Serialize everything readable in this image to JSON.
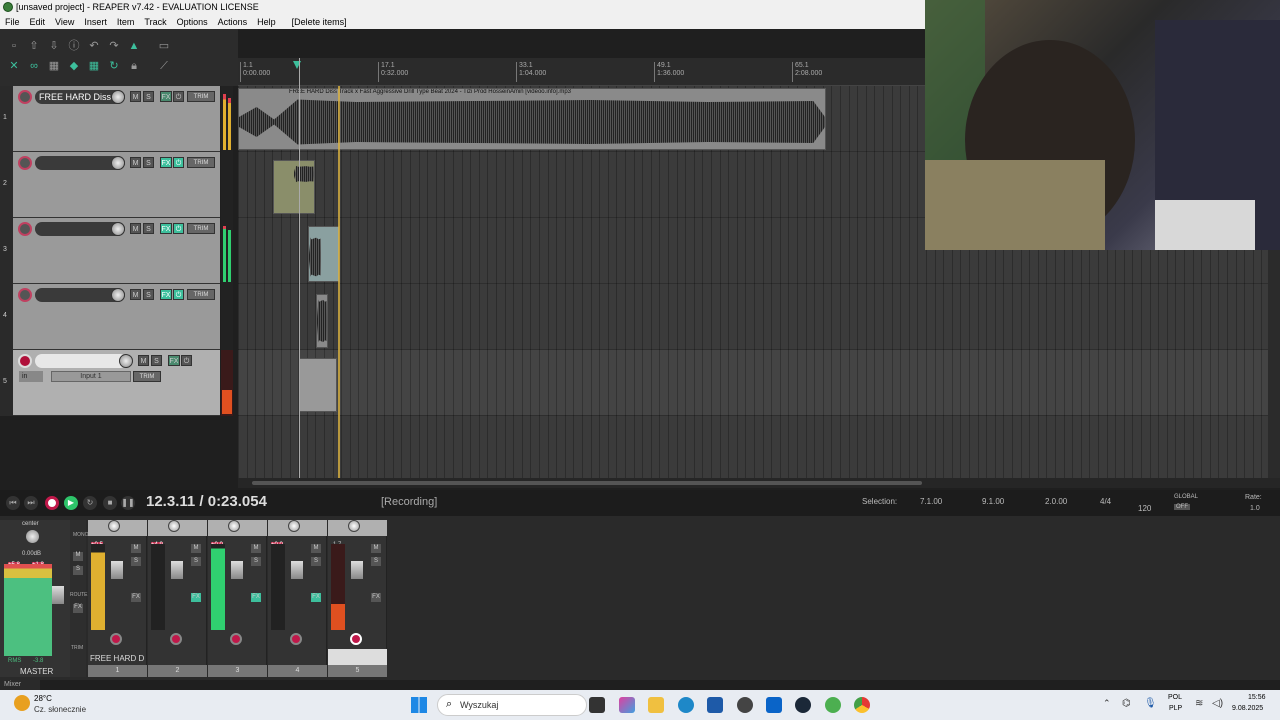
{
  "window": {
    "title": "[unsaved project] - REAPER v7.42 - EVALUATION LICENSE"
  },
  "menu": [
    "File",
    "Edit",
    "View",
    "Insert",
    "Item",
    "Track",
    "Options",
    "Actions",
    "Help",
    "[Delete items]"
  ],
  "ruler": {
    "marks": [
      {
        "bar": "1.1",
        "time": "0:00.000"
      },
      {
        "bar": "17.1",
        "time": "0:32.000"
      },
      {
        "bar": "33.1",
        "time": "1:04.000"
      },
      {
        "bar": "49.1",
        "time": "1:36.000"
      },
      {
        "bar": "65.1",
        "time": "2:08.000"
      }
    ]
  },
  "tracks": [
    {
      "num": "1",
      "name": "FREE HARD Diss Tr",
      "trim": "TRIM"
    },
    {
      "num": "2",
      "name": "",
      "trim": "TRIM"
    },
    {
      "num": "3",
      "name": "",
      "trim": "TRIM"
    },
    {
      "num": "4",
      "name": "",
      "trim": "TRIM"
    },
    {
      "num": "5",
      "name": "",
      "trim": "TRIM",
      "input": "Input 1",
      "in_label": "in"
    }
  ],
  "item": {
    "label": "FREE HARD Diss Track x Fast Aggressive Drill Type Beat 2024 - Tizi Prod HosseinAmin [videoo.info].mp3"
  },
  "transport": {
    "position": "12.3.11 / 0:23.054",
    "state": "[Recording]",
    "selection_label": "Selection:",
    "selection_start": "7.1.00",
    "selection_end": "9.1.00",
    "selection_len": "2.0.00",
    "timesig": "4/4",
    "bpm": "120",
    "global_label": "GLOBAL",
    "global_state": "OFF",
    "rate_label": "Rate:",
    "rate_value": "1.0"
  },
  "mixer": {
    "master_label": "MASTER",
    "master_pan": "center",
    "master_vol": "0.00dB",
    "master_peak_l": "+5.8",
    "master_peak_r": "+1.8",
    "master_rms": "RMS",
    "master_rms_val": "-3.8",
    "strips": [
      {
        "num": "1",
        "name": "FREE HARD D",
        "peak": "+0.5"
      },
      {
        "num": "2",
        "name": "",
        "peak": "+4.9"
      },
      {
        "num": "3",
        "name": "",
        "peak": "+0.0"
      },
      {
        "num": "4",
        "name": "",
        "peak": "+0.0"
      },
      {
        "num": "5",
        "name": "",
        "peak": "-1.7"
      }
    ],
    "side_labels": [
      "MONO",
      "ROUTE",
      "TRIM"
    ],
    "tab": "Mixer"
  },
  "taskbar": {
    "weather_temp": "28°C",
    "weather_desc": "Cz. słonecznie",
    "search_placeholder": "Wyszukaj",
    "lang1": "POL",
    "lang2": "PLP",
    "time": "15:56",
    "date": "9.08.2025"
  },
  "colors": {
    "record": "#c0184a",
    "play": "#2ec46a",
    "accent_green": "#3dbf9c"
  }
}
